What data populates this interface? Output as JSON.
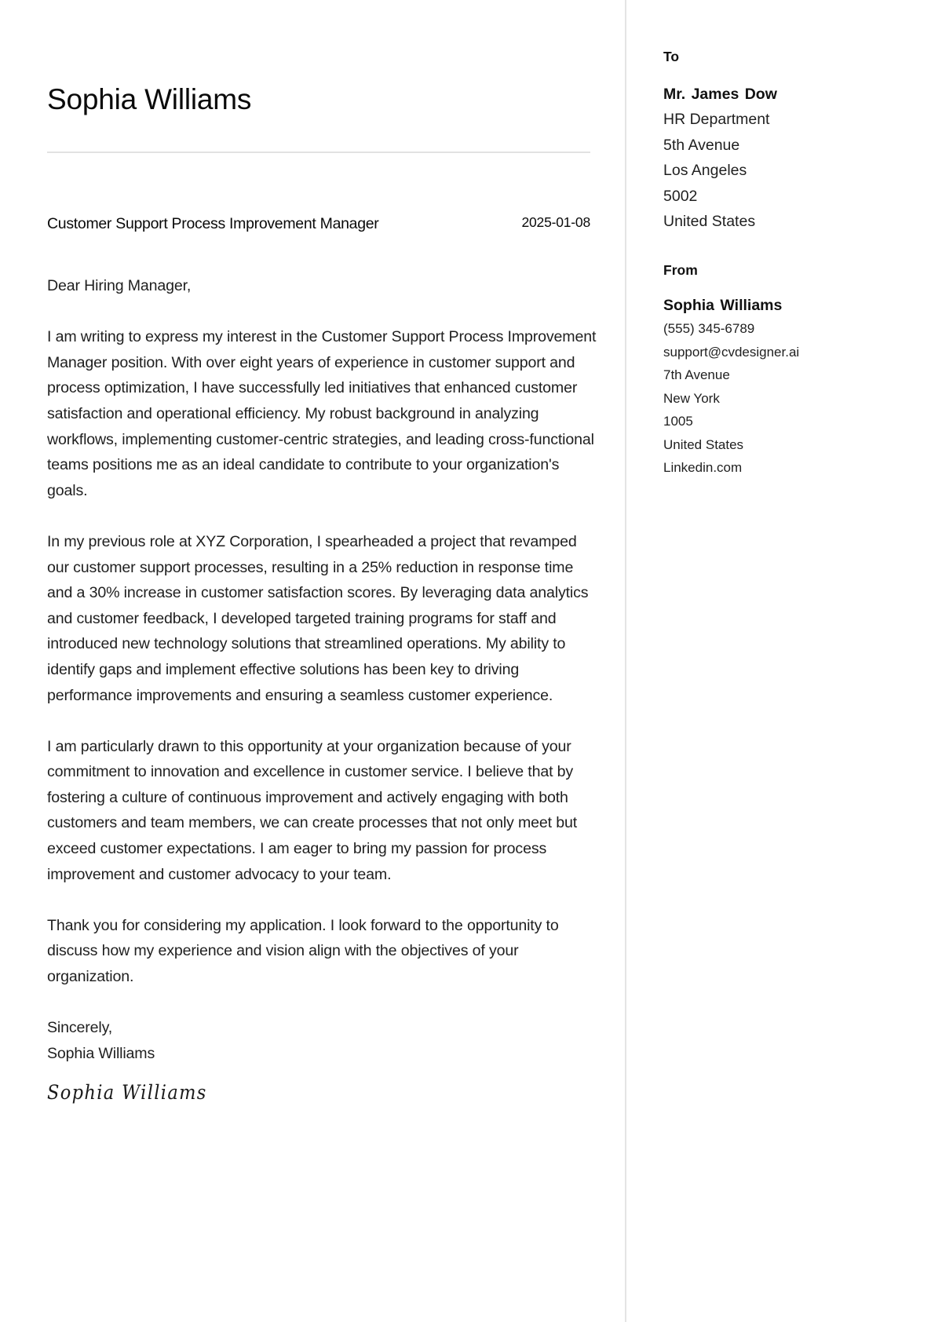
{
  "header": {
    "name": "Sophia Williams",
    "job_title": "Customer Support Process Improvement Manager",
    "date": "2025-01-08"
  },
  "letter": {
    "greeting": "Dear Hiring Manager,",
    "paragraphs": [
      "I am writing to express my interest in the Customer Support Process Improvement Manager position. With over eight years of experience in customer support and process optimization, I have successfully led initiatives that enhanced customer satisfaction and operational efficiency. My robust background in analyzing workflows, implementing customer-centric strategies, and leading cross-functional teams positions me as an ideal candidate to contribute to your organization's goals.",
      "In my previous role at XYZ Corporation, I spearheaded a project that revamped our customer support processes, resulting in a 25% reduction in response time and a 30% increase in customer satisfaction scores. By leveraging data analytics and customer feedback, I developed targeted training programs for staff and introduced new technology solutions that streamlined operations. My ability to identify gaps and implement effective solutions has been key to driving performance improvements and ensuring a seamless customer experience.",
      "I am particularly drawn to this opportunity at your organization because of your commitment to innovation and excellence in customer service. I believe that by fostering a culture of continuous improvement and actively engaging with both customers and team members, we can create processes that not only meet but exceed customer expectations. I am eager to bring my passion for process improvement and customer advocacy to your team.",
      "Thank you for considering my application. I look forward to the opportunity to discuss how my experience and vision align with the objectives of your organization."
    ],
    "closing": "Sincerely,",
    "sender_name": "Sophia Williams",
    "signature": "Sophia Williams"
  },
  "sidebar": {
    "to": {
      "label": "To",
      "name": "Mr. James Dow",
      "lines": [
        "HR Department",
        "5th Avenue",
        "Los Angeles",
        "5002",
        "United States"
      ]
    },
    "from": {
      "label": "From",
      "name": "Sophia Williams",
      "phone": "(555) 345-6789",
      "email": "support@cvdesigner.ai",
      "lines": [
        "7th Avenue",
        "New York",
        "1005",
        "United States"
      ],
      "website": "Linkedin.com"
    }
  }
}
